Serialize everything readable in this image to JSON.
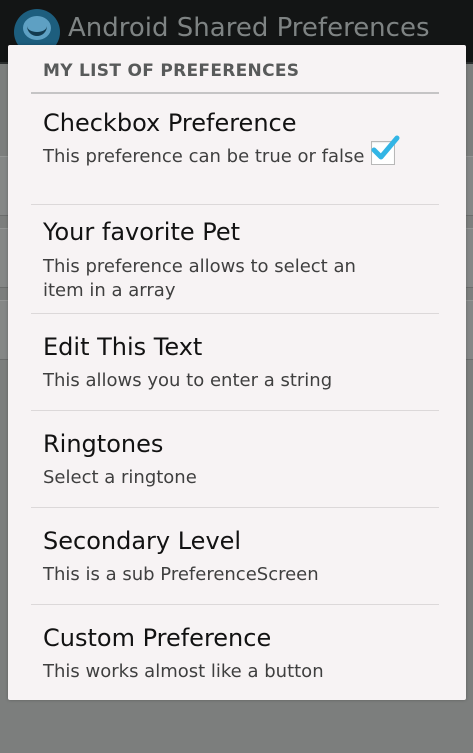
{
  "app_bar": {
    "title": "Android Shared Preferences",
    "icon": "android-app-icon"
  },
  "dialog": {
    "header": "MY LIST OF PREFERENCES",
    "items": [
      {
        "title": "Checkbox Preference",
        "summary": "This preference can be true or false",
        "checked": true,
        "checkbox_color": "#33b5e5"
      },
      {
        "title": "Your favorite Pet",
        "summary": "This preference allows to select an item in a array"
      },
      {
        "title": "Edit This Text",
        "summary": "This allows you to enter a string"
      },
      {
        "title": "Ringtones",
        "summary": "Select a ringtone"
      },
      {
        "title": "Secondary Level",
        "summary": "This is a sub PreferenceScreen"
      },
      {
        "title": "Custom Preference",
        "summary": "This works almost like a button"
      }
    ]
  }
}
